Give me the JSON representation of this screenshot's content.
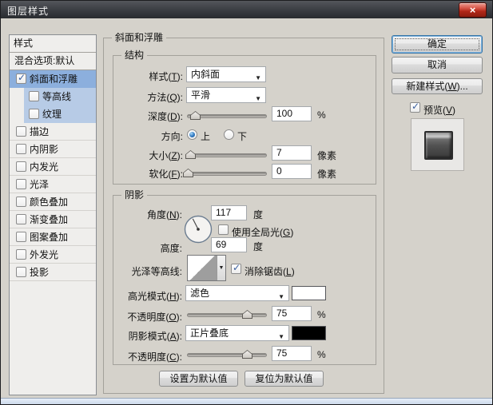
{
  "window": {
    "title": "图层样式",
    "close": "×"
  },
  "icons": {
    "check": "✓",
    "dropdown_arrow": "▼"
  },
  "sidebar": {
    "header": "样式",
    "blend_options": "混合选项:默认",
    "items": [
      {
        "label": "斜面和浮雕",
        "checked": true,
        "bg": "selected"
      },
      {
        "label": "等高线",
        "checked": false,
        "bg": "child"
      },
      {
        "label": "纹理",
        "checked": false,
        "bg": "child"
      },
      {
        "label": "描边",
        "checked": false,
        "bg": "none"
      },
      {
        "label": "内阴影",
        "checked": false,
        "bg": "none"
      },
      {
        "label": "内发光",
        "checked": false,
        "bg": "none"
      },
      {
        "label": "光泽",
        "checked": false,
        "bg": "none"
      },
      {
        "label": "颜色叠加",
        "checked": false,
        "bg": "none"
      },
      {
        "label": "渐变叠加",
        "checked": false,
        "bg": "none"
      },
      {
        "label": "图案叠加",
        "checked": false,
        "bg": "none"
      },
      {
        "label": "外发光",
        "checked": false,
        "bg": "none"
      },
      {
        "label": "投影",
        "checked": false,
        "bg": "none"
      }
    ]
  },
  "main": {
    "group_title": "斜面和浮雕",
    "structure": {
      "title": "结构",
      "style_label": "样式(T):",
      "style_value": "内斜面",
      "technique_label": "方法(Q):",
      "technique_value": "平滑",
      "depth_label": "深度(D):",
      "depth_value": "100",
      "depth_unit": "%",
      "direction_label": "方向:",
      "direction_up": "上",
      "direction_down": "下",
      "size_label": "大小(Z):",
      "size_value": "7",
      "size_unit": "像素",
      "soften_label": "软化(F):",
      "soften_value": "0",
      "soften_unit": "像素"
    },
    "shading": {
      "title": "阴影",
      "angle_label": "角度(N):",
      "angle_value": "117",
      "angle_unit": "度",
      "global_light_label": "使用全局光(G)",
      "altitude_label": "高度:",
      "altitude_value": "69",
      "altitude_unit": "度",
      "gloss_contour_label": "光泽等高线:",
      "anti_alias_label": "消除锯齿(L)",
      "highlight_mode_label": "高光模式(H):",
      "highlight_mode_value": "滤色",
      "highlight_color": "#ffffff",
      "highlight_opacity_label": "不透明度(O):",
      "highlight_opacity_value": "75",
      "highlight_opacity_unit": "%",
      "shadow_mode_label": "阴影模式(A):",
      "shadow_mode_value": "正片叠底",
      "shadow_color": "#000000",
      "shadow_opacity_label": "不透明度(C):",
      "shadow_opacity_value": "75",
      "shadow_opacity_unit": "%"
    },
    "footer": {
      "set_default": "设置为默认值",
      "reset_default": "复位为默认值"
    }
  },
  "actions": {
    "ok": "确定",
    "cancel": "取消",
    "new_style": "新建样式(W)...",
    "preview": "预览(V)"
  },
  "colors": {
    "selected_item_bg": "#8cafdd",
    "child_item_bg": "#b7cbe6",
    "dialog_bg": "#d5d2cb",
    "titlebar_bg": "#3e4146",
    "close_button_red": "#b12718"
  }
}
